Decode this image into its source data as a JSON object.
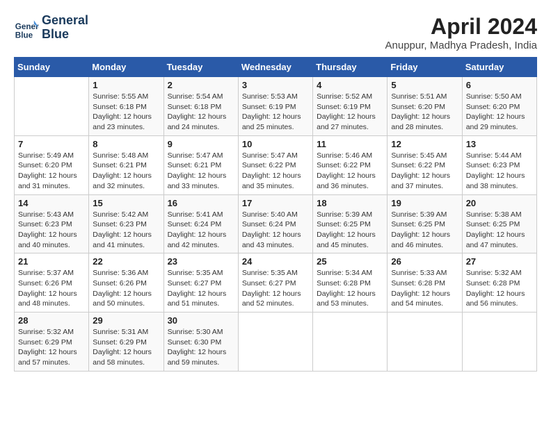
{
  "header": {
    "logo_line1": "General",
    "logo_line2": "Blue",
    "month_title": "April 2024",
    "location": "Anuppur, Madhya Pradesh, India"
  },
  "weekdays": [
    "Sunday",
    "Monday",
    "Tuesday",
    "Wednesday",
    "Thursday",
    "Friday",
    "Saturday"
  ],
  "weeks": [
    [
      {
        "day": "",
        "info": ""
      },
      {
        "day": "1",
        "info": "Sunrise: 5:55 AM\nSunset: 6:18 PM\nDaylight: 12 hours\nand 23 minutes."
      },
      {
        "day": "2",
        "info": "Sunrise: 5:54 AM\nSunset: 6:18 PM\nDaylight: 12 hours\nand 24 minutes."
      },
      {
        "day": "3",
        "info": "Sunrise: 5:53 AM\nSunset: 6:19 PM\nDaylight: 12 hours\nand 25 minutes."
      },
      {
        "day": "4",
        "info": "Sunrise: 5:52 AM\nSunset: 6:19 PM\nDaylight: 12 hours\nand 27 minutes."
      },
      {
        "day": "5",
        "info": "Sunrise: 5:51 AM\nSunset: 6:20 PM\nDaylight: 12 hours\nand 28 minutes."
      },
      {
        "day": "6",
        "info": "Sunrise: 5:50 AM\nSunset: 6:20 PM\nDaylight: 12 hours\nand 29 minutes."
      }
    ],
    [
      {
        "day": "7",
        "info": "Sunrise: 5:49 AM\nSunset: 6:20 PM\nDaylight: 12 hours\nand 31 minutes."
      },
      {
        "day": "8",
        "info": "Sunrise: 5:48 AM\nSunset: 6:21 PM\nDaylight: 12 hours\nand 32 minutes."
      },
      {
        "day": "9",
        "info": "Sunrise: 5:47 AM\nSunset: 6:21 PM\nDaylight: 12 hours\nand 33 minutes."
      },
      {
        "day": "10",
        "info": "Sunrise: 5:47 AM\nSunset: 6:22 PM\nDaylight: 12 hours\nand 35 minutes."
      },
      {
        "day": "11",
        "info": "Sunrise: 5:46 AM\nSunset: 6:22 PM\nDaylight: 12 hours\nand 36 minutes."
      },
      {
        "day": "12",
        "info": "Sunrise: 5:45 AM\nSunset: 6:22 PM\nDaylight: 12 hours\nand 37 minutes."
      },
      {
        "day": "13",
        "info": "Sunrise: 5:44 AM\nSunset: 6:23 PM\nDaylight: 12 hours\nand 38 minutes."
      }
    ],
    [
      {
        "day": "14",
        "info": "Sunrise: 5:43 AM\nSunset: 6:23 PM\nDaylight: 12 hours\nand 40 minutes."
      },
      {
        "day": "15",
        "info": "Sunrise: 5:42 AM\nSunset: 6:23 PM\nDaylight: 12 hours\nand 41 minutes."
      },
      {
        "day": "16",
        "info": "Sunrise: 5:41 AM\nSunset: 6:24 PM\nDaylight: 12 hours\nand 42 minutes."
      },
      {
        "day": "17",
        "info": "Sunrise: 5:40 AM\nSunset: 6:24 PM\nDaylight: 12 hours\nand 43 minutes."
      },
      {
        "day": "18",
        "info": "Sunrise: 5:39 AM\nSunset: 6:25 PM\nDaylight: 12 hours\nand 45 minutes."
      },
      {
        "day": "19",
        "info": "Sunrise: 5:39 AM\nSunset: 6:25 PM\nDaylight: 12 hours\nand 46 minutes."
      },
      {
        "day": "20",
        "info": "Sunrise: 5:38 AM\nSunset: 6:25 PM\nDaylight: 12 hours\nand 47 minutes."
      }
    ],
    [
      {
        "day": "21",
        "info": "Sunrise: 5:37 AM\nSunset: 6:26 PM\nDaylight: 12 hours\nand 48 minutes."
      },
      {
        "day": "22",
        "info": "Sunrise: 5:36 AM\nSunset: 6:26 PM\nDaylight: 12 hours\nand 50 minutes."
      },
      {
        "day": "23",
        "info": "Sunrise: 5:35 AM\nSunset: 6:27 PM\nDaylight: 12 hours\nand 51 minutes."
      },
      {
        "day": "24",
        "info": "Sunrise: 5:35 AM\nSunset: 6:27 PM\nDaylight: 12 hours\nand 52 minutes."
      },
      {
        "day": "25",
        "info": "Sunrise: 5:34 AM\nSunset: 6:28 PM\nDaylight: 12 hours\nand 53 minutes."
      },
      {
        "day": "26",
        "info": "Sunrise: 5:33 AM\nSunset: 6:28 PM\nDaylight: 12 hours\nand 54 minutes."
      },
      {
        "day": "27",
        "info": "Sunrise: 5:32 AM\nSunset: 6:28 PM\nDaylight: 12 hours\nand 56 minutes."
      }
    ],
    [
      {
        "day": "28",
        "info": "Sunrise: 5:32 AM\nSunset: 6:29 PM\nDaylight: 12 hours\nand 57 minutes."
      },
      {
        "day": "29",
        "info": "Sunrise: 5:31 AM\nSunset: 6:29 PM\nDaylight: 12 hours\nand 58 minutes."
      },
      {
        "day": "30",
        "info": "Sunrise: 5:30 AM\nSunset: 6:30 PM\nDaylight: 12 hours\nand 59 minutes."
      },
      {
        "day": "",
        "info": ""
      },
      {
        "day": "",
        "info": ""
      },
      {
        "day": "",
        "info": ""
      },
      {
        "day": "",
        "info": ""
      }
    ]
  ]
}
